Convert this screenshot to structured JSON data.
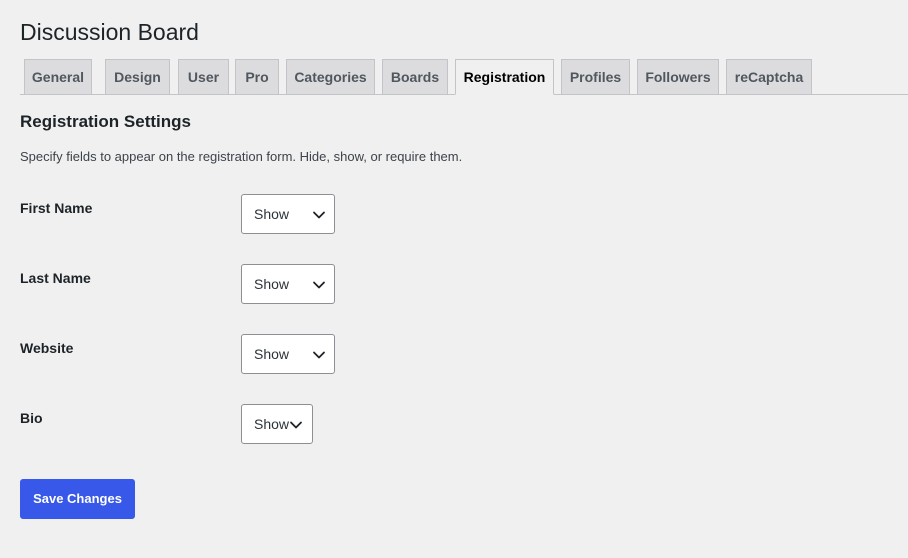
{
  "page_title": "Discussion Board",
  "tabs": [
    {
      "label": "General"
    },
    {
      "label": "Design"
    },
    {
      "label": "User"
    },
    {
      "label": "Pro"
    },
    {
      "label": "Categories"
    },
    {
      "label": "Boards"
    },
    {
      "label": "Registration",
      "active": true
    },
    {
      "label": "Profiles"
    },
    {
      "label": "Followers"
    },
    {
      "label": "reCaptcha"
    }
  ],
  "section": {
    "title": "Registration Settings",
    "description": "Specify fields to appear on the registration form. Hide, show, or require them."
  },
  "fields": [
    {
      "label": "First Name",
      "value": "Show"
    },
    {
      "label": "Last Name",
      "value": "Show"
    },
    {
      "label": "Website",
      "value": "Show"
    },
    {
      "label": "Bio",
      "value": "Show"
    }
  ],
  "save_label": "Save Changes",
  "icons": {
    "select_chevron": "chevron-down-icon"
  },
  "colors": {
    "primary_button": "#3858e9",
    "background": "#f0f0f1",
    "tab_inactive": "#dcdcde"
  }
}
